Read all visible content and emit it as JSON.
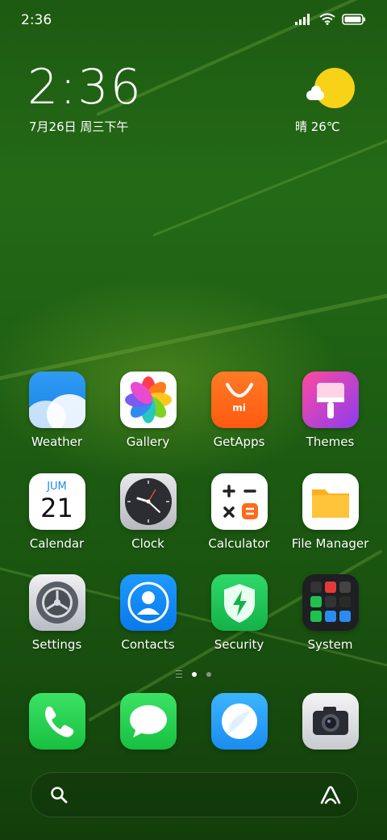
{
  "status_bar": {
    "time": "2:36"
  },
  "clock_widget": {
    "time": "2:36",
    "date": "7月26日 周三下午"
  },
  "weather_widget": {
    "condition_temp": "晴 26℃"
  },
  "apps": {
    "weather": "Weather",
    "gallery": "Gallery",
    "getapps": "GetApps",
    "themes": "Themes",
    "calendar": "Calendar",
    "calendar_month": "JUM",
    "calendar_day": "21",
    "clock": "Clock",
    "calculator": "Calculator",
    "file_manager": "File Manager",
    "settings": "Settings",
    "contacts": "Contacts",
    "security": "Security",
    "system": "System"
  },
  "getapps_logo": "mi",
  "dock": [
    "Phone",
    "Messages",
    "Browser",
    "Camera"
  ],
  "page_indicator": {
    "pages": 2,
    "current": 1
  }
}
